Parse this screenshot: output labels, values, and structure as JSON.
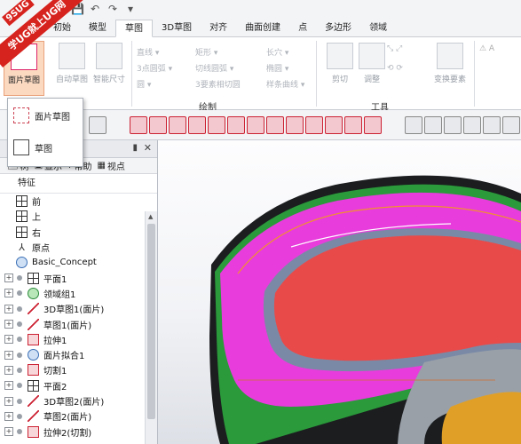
{
  "logo": {
    "top": "9SUG",
    "text": "学UG就上UG网"
  },
  "tabs": [
    "初始",
    "模型",
    "草图",
    "3D草图",
    "对齐",
    "曲面创建",
    "点",
    "多边形",
    "领域"
  ],
  "active_tab_index": 2,
  "ribbon": {
    "buttons": {
      "sheet_sketch": "面片草图",
      "auto_sketch": "自动草图",
      "smart_dim": "智能尺寸",
      "line": "直线",
      "rect": "矩形",
      "slot": "长穴",
      "arc3": "3点圆弧",
      "tangent_arc": "切线圆弧",
      "ellipse": "椭圆",
      "circle": "圆",
      "arc_by_3": "3要素相切圆",
      "spline": "样条曲线",
      "trim": "剪切",
      "adjust": "调整",
      "transform": "变换要素"
    },
    "groups": {
      "draw": "绘制",
      "tools": "工具"
    }
  },
  "popup": {
    "item1": "面片草图",
    "item2": "草图"
  },
  "panel": {
    "tabs": [
      "树",
      "显示",
      "帮助",
      "视点"
    ],
    "feature_title": "特征",
    "tree": [
      {
        "label": "前",
        "icon": "plane"
      },
      {
        "label": "上",
        "icon": "plane"
      },
      {
        "label": "右",
        "icon": "plane"
      },
      {
        "label": "原点",
        "icon": "origin"
      },
      {
        "label": "Basic_Concept",
        "icon": "solid"
      },
      {
        "label": "平面1",
        "icon": "plane"
      },
      {
        "label": "领域组1",
        "icon": "region"
      },
      {
        "label": "3D草图1(面片)",
        "icon": "sketch"
      },
      {
        "label": "草图1(面片)",
        "icon": "sketch"
      },
      {
        "label": "拉伸1",
        "icon": "extrude"
      },
      {
        "label": "面片拟合1",
        "icon": "solid"
      },
      {
        "label": "切割1",
        "icon": "extrude"
      },
      {
        "label": "平面2",
        "icon": "plane"
      },
      {
        "label": "3D草图2(面片)",
        "icon": "sketch"
      },
      {
        "label": "草图2(面片)",
        "icon": "sketch"
      },
      {
        "label": "拉伸2(切割)",
        "icon": "extrude"
      }
    ]
  }
}
